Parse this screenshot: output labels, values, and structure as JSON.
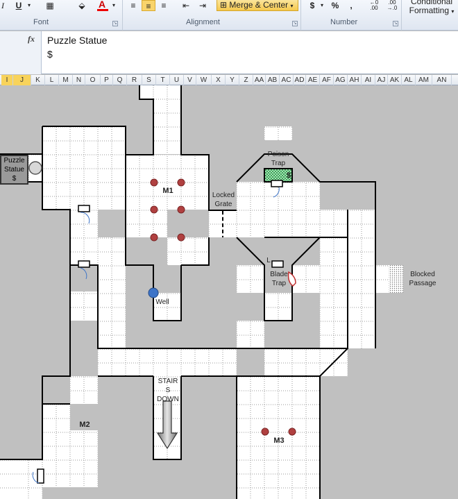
{
  "ribbon": {
    "groups": [
      {
        "name": "Font"
      },
      {
        "name": "Alignment"
      },
      {
        "name": "Number"
      }
    ],
    "italic": "I",
    "underline": "U",
    "font_color": "A",
    "merge_center": "Merge & Center",
    "currency": "$",
    "percent": "%",
    "comma": ",",
    "conditional": "Conditional",
    "formatting": "Formatting"
  },
  "formula_bar": {
    "fx": "fx",
    "line1": "Puzzle Statue",
    "line2": "$"
  },
  "columns": [
    "I",
    "J",
    "K",
    "L",
    "M",
    "N",
    "O",
    "P",
    "Q",
    "R",
    "S",
    "T",
    "U",
    "V",
    "W",
    "X",
    "Y",
    "Z",
    "AA",
    "AB",
    "AC",
    "AD",
    "AE",
    "AF",
    "AG",
    "AH",
    "AI",
    "AJ",
    "AK",
    "AL",
    "AM",
    "AN"
  ],
  "selected_columns": [
    "I",
    "J"
  ],
  "map": {
    "puzzle_statue": [
      "Puzzle",
      "Statue",
      "$"
    ],
    "poison_trap": [
      "Poison",
      "Trap"
    ],
    "poison_dollar": "$",
    "locked_grate": [
      "Locked",
      "Grate"
    ],
    "blade_trap": [
      "Blade",
      "Trap"
    ],
    "blade_l": "L",
    "blocked_passage": [
      "Blocked",
      "Passage"
    ],
    "m1": "M1",
    "m2": "M2",
    "m3": "M3",
    "well": "Well",
    "stairs": [
      "STAIR",
      "S",
      "DOWN"
    ]
  }
}
